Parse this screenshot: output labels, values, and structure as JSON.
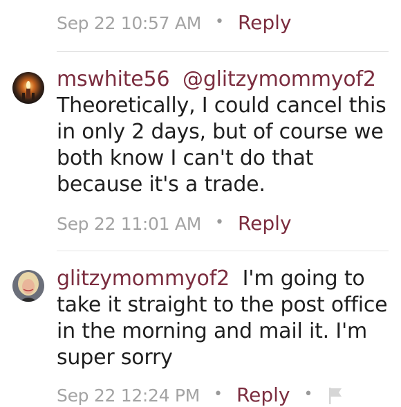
{
  "comments": [
    {
      "timestamp": "Sep 22 10:57 AM",
      "reply_label": "Reply"
    },
    {
      "username": "mswhite56",
      "mention": "@glitzymommyof2",
      "body": "Theoretically, I could cancel this in only 2 days, but of course we both know I can't do that because it's a trade.",
      "timestamp": "Sep 22 11:01 AM",
      "reply_label": "Reply",
      "avatar_icon": "candle-avatar-icon"
    },
    {
      "username": "glitzymommyof2",
      "body": "I'm going to take it straight to the post office in the morning and mail it.  I'm super sorry",
      "timestamp": "Sep 22 12:24 PM",
      "reply_label": "Reply",
      "avatar_icon": "woman-portrait-avatar-icon",
      "flag_icon": "flag-icon"
    }
  ],
  "colors": {
    "accent": "#7b2d3f",
    "timestamp": "#a3a3a3",
    "text": "#1f1f1f",
    "divider": "#e2e2e2"
  }
}
